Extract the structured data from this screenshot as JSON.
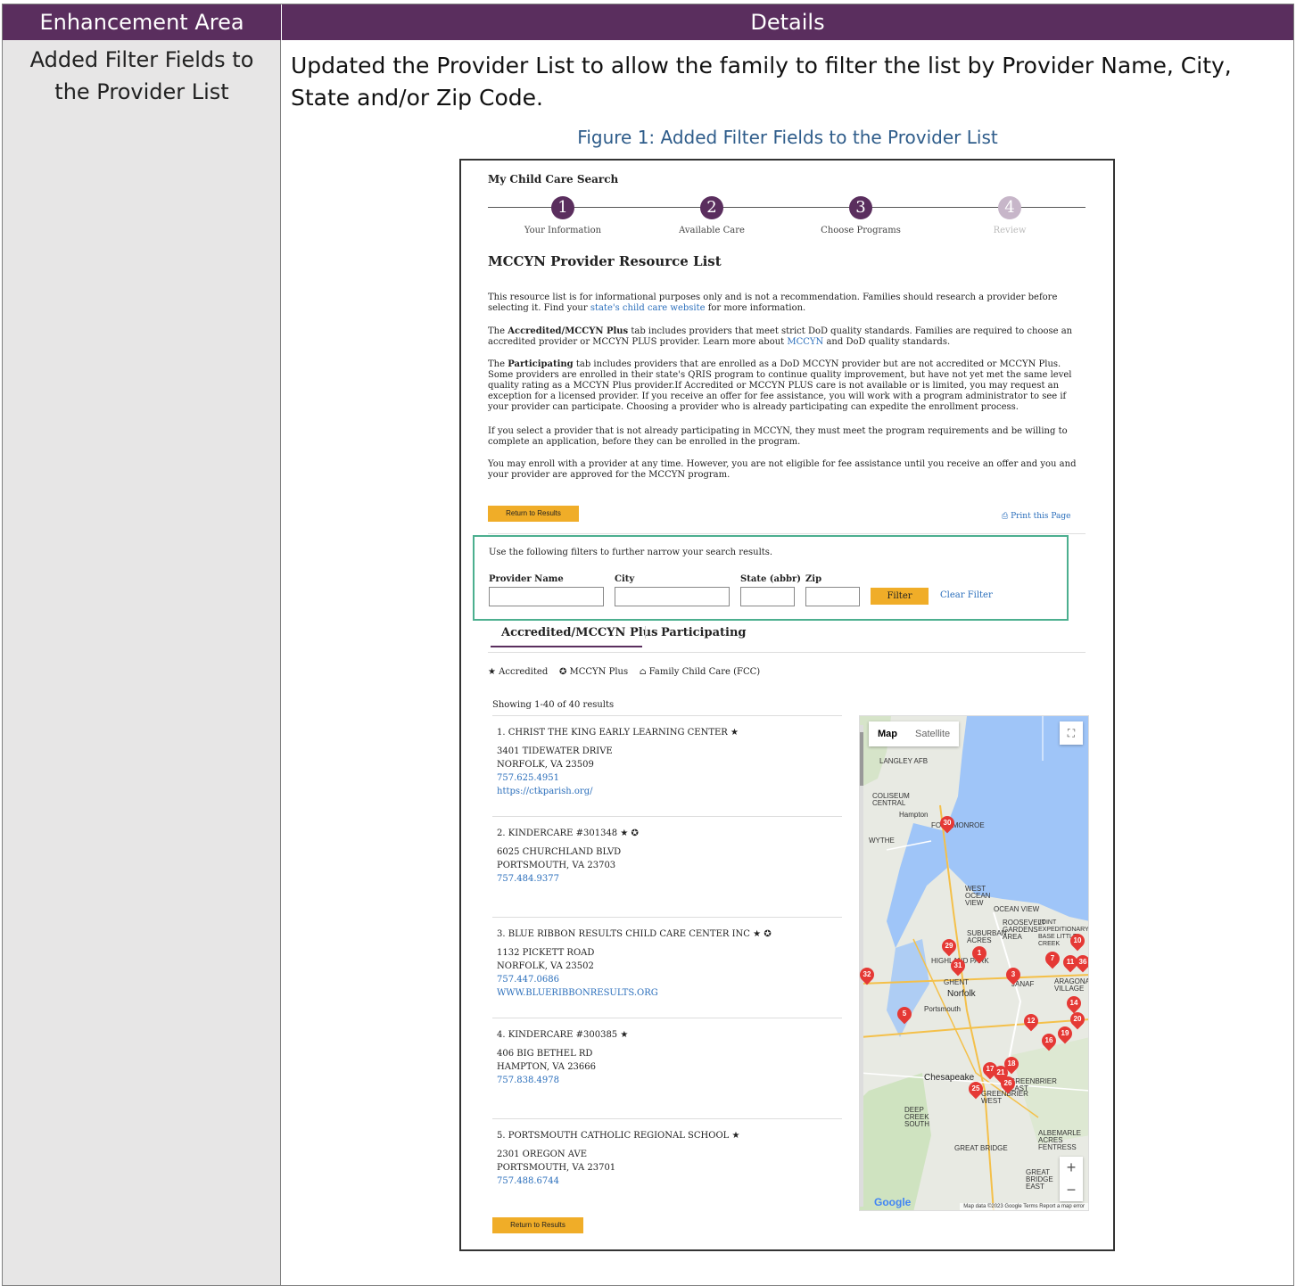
{
  "table": {
    "col1_header": "Enhancement Area",
    "col2_header": "Details",
    "area": "Added Filter Fields to the Provider List",
    "details": "Updated the Provider List to allow the family to filter the list by Provider Name, City, State and/or Zip Code.",
    "caption": "Figure 1: Added Filter Fields to the Provider List"
  },
  "screenshot": {
    "title": "My Child Care Search",
    "steps": [
      {
        "num": "1",
        "label": "Your Information"
      },
      {
        "num": "2",
        "label": "Available Care"
      },
      {
        "num": "3",
        "label": "Choose Programs"
      },
      {
        "num": "4",
        "label": "Review"
      }
    ],
    "heading": "MCCYN Provider Resource List",
    "para1_a": "This resource list is for informational purposes only and is not a recommendation. Families should research a provider before selecting it. Find your ",
    "para1_link": "state's child care website",
    "para1_b": " for more information.",
    "para2_a": "The ",
    "para2_bold": "Accredited/MCCYN Plus",
    "para2_b": " tab includes providers that meet strict DoD quality standards. Families are required to choose an accredited provider or MCCYN PLUS provider. Learn more about ",
    "para2_link": "MCCYN",
    "para2_c": " and DoD quality standards.",
    "para3_a": "The ",
    "para3_bold": "Participating",
    "para3_b": " tab includes providers that are enrolled as a DoD MCCYN provider but are not accredited or MCCYN Plus. Some providers are enrolled in their state's QRIS program to continue quality improvement, but have not yet met the same level quality rating as a MCCYN Plus provider.If Accredited or MCCYN PLUS care is not available or is limited, you may request an exception for a licensed provider. If you receive an offer for fee assistance, you will work with a program administrator to see if your provider can participate. Choosing a provider who is already participating can expedite the enrollment process.",
    "para4": "If you select a provider that is not already participating in MCCYN, they must meet the program requirements and be willing to complete an application, before they can be enrolled in the program.",
    "para5": "You may enroll with a provider at any time. However, you are not eligible for fee assistance until you receive an offer and you and your provider are approved for the MCCYN program.",
    "return_btn": "Return to Results",
    "print_link": "Print this Page",
    "filter_intro": "Use the following filters to further narrow your search results.",
    "filter_labels": {
      "name": "Provider Name",
      "city": "City",
      "state": "State (abbr)",
      "zip": "Zip"
    },
    "filter_btn": "Filter",
    "clear_filter": "Clear Filter",
    "tabs": [
      "Accredited/MCCYN Plus",
      "Participating"
    ],
    "legend": {
      "accredited": "Accredited",
      "plus": "MCCYN Plus",
      "fcc": "Family Child Care (FCC)"
    },
    "showing": "Showing 1-40 of 40 results",
    "results": [
      {
        "name": "1. CHRIST THE KING EARLY LEARNING CENTER",
        "addr1": "3401 TIDEWATER DRIVE",
        "addr2": "NORFOLK, VA 23509",
        "phone": "757.625.4951",
        "web": "https://ctkparish.org/"
      },
      {
        "name": "2. KINDERCARE #301348",
        "addr1": "6025 CHURCHLAND BLVD",
        "addr2": "PORTSMOUTH, VA 23703",
        "phone": "757.484.9377",
        "web": ""
      },
      {
        "name": "3. BLUE RIBBON RESULTS CHILD CARE CENTER INC",
        "addr1": "1132 PICKETT ROAD",
        "addr2": "NORFOLK, VA 23502",
        "phone": "757.447.0686",
        "web": "WWW.BLUERIBBONRESULTS.ORG"
      },
      {
        "name": "4. KINDERCARE #300385",
        "addr1": "406 BIG BETHEL RD",
        "addr2": "HAMPTON, VA 23666",
        "phone": "757.838.4978",
        "web": ""
      },
      {
        "name": "5. PORTSMOUTH CATHOLIC REGIONAL SCHOOL",
        "addr1": "2301 OREGON AVE",
        "addr2": "PORTSMOUTH, VA 23701",
        "phone": "757.488.6744",
        "web": ""
      }
    ],
    "map": {
      "btn_map": "Map",
      "btn_satellite": "Satellite",
      "attribution": "Map data ©2023 Google   Terms   Report a map error",
      "google": "Google",
      "places": [
        "LANGLEY AFB",
        "Hampton",
        "COLISEUM CENTRAL",
        "WYTHE",
        "FORT MONROE",
        "WEST OCEAN VIEW",
        "OCEAN VIEW",
        "SUBURBAN ACRES",
        "ROOSEVELT GARDENS AREA",
        "JOINT EXPEDITIONARY BASE LITTLE CREEK",
        "HIGHLAND PARK",
        "GHENT",
        "Norfolk",
        "Portsmouth",
        "JANAF",
        "ARAGONA VILLAGE",
        "Chesapeake",
        "GREENBRIER EAST",
        "GREENBRIER WEST",
        "DEEP CREEK SOUTH",
        "GREAT BRIDGE",
        "ALBEMARLE ACRES FENTRESS",
        "GREAT BRIDGE EAST"
      ],
      "pins": [
        "1",
        "3",
        "5",
        "7",
        "10",
        "11",
        "12",
        "14",
        "16",
        "17",
        "18",
        "19",
        "20",
        "21",
        "25",
        "26",
        "29",
        "30",
        "31",
        "32",
        "36"
      ]
    }
  }
}
